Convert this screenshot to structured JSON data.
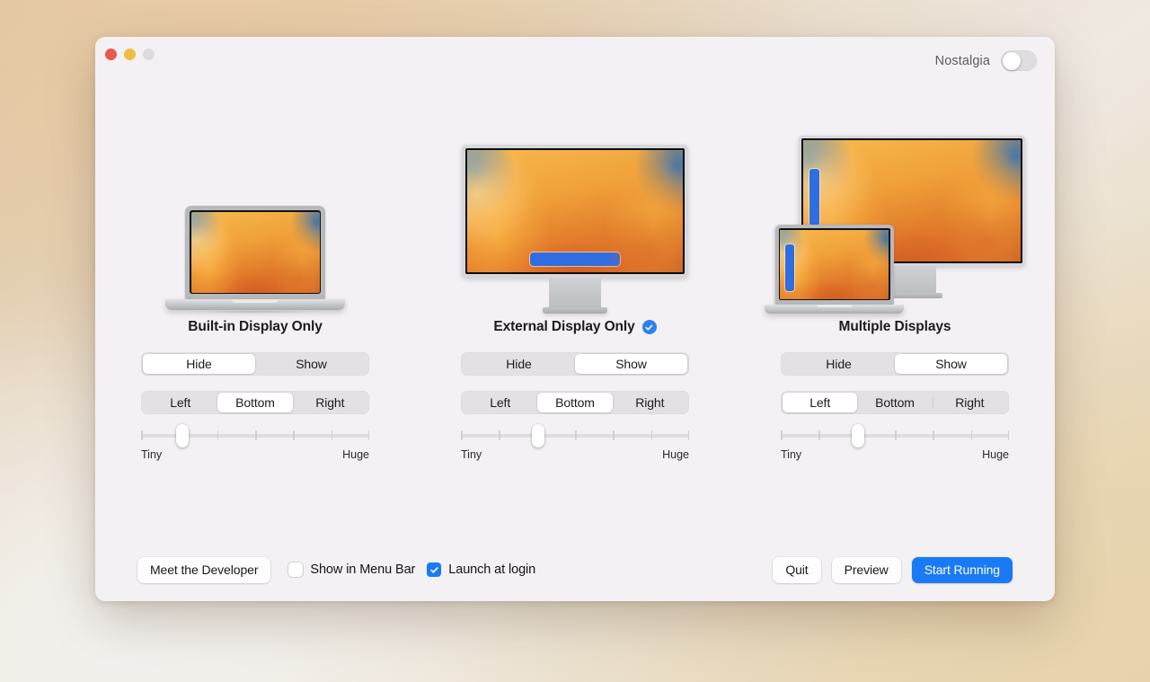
{
  "window": {
    "traffic_lights": [
      "close",
      "minimize",
      "zoom"
    ],
    "nostalgia_label": "Nostalgia",
    "nostalgia_on": false
  },
  "colors": {
    "accent_blue": "#1a7af5",
    "badge_blue": "#2d7ff0",
    "dock_blue": "#2f6ee0",
    "window_bg": "#f4f1f4",
    "segment_track": "#e4e1e5",
    "close_red": "#e8594f",
    "minimize_yellow": "#f0bd40",
    "zoom_gray": "#dcdcdf"
  },
  "slider": {
    "min_label": "Tiny",
    "max_label": "Huge",
    "tick_count": 7
  },
  "visibility_options": [
    "Hide",
    "Show"
  ],
  "position_options": [
    "Left",
    "Bottom",
    "Right"
  ],
  "columns": [
    {
      "id": "built-in-display-only",
      "title": "Built-in Display Only",
      "active": false,
      "artwork": "macbook",
      "visibility": [
        "Hide",
        "Show"
      ],
      "visibility_selected": "Hide",
      "position": [
        "Left",
        "Bottom",
        "Right"
      ],
      "position_selected": "Bottom",
      "slider_value": 18,
      "slider_min_label": "Tiny",
      "slider_max_label": "Huge"
    },
    {
      "id": "external-display-only",
      "title": "External Display Only",
      "active": true,
      "artwork": "external-monitor",
      "visibility": [
        "Hide",
        "Show"
      ],
      "visibility_selected": "Show",
      "position": [
        "Left",
        "Bottom",
        "Right"
      ],
      "position_selected": "Bottom",
      "slider_value": 34,
      "slider_min_label": "Tiny",
      "slider_max_label": "Huge"
    },
    {
      "id": "multiple-displays",
      "title": "Multiple Displays",
      "active": false,
      "artwork": "monitor-and-macbook",
      "visibility": [
        "Hide",
        "Show"
      ],
      "visibility_selected": "Show",
      "position": [
        "Left",
        "Bottom",
        "Right"
      ],
      "position_selected": "Left",
      "slider_value": 34,
      "slider_min_label": "Tiny",
      "slider_max_label": "Huge"
    }
  ],
  "footer": {
    "meet_developer_label": "Meet the Developer",
    "show_in_menu_bar_label": "Show in Menu Bar",
    "show_in_menu_bar_checked": false,
    "launch_at_login_label": "Launch at login",
    "launch_at_login_checked": true,
    "quit_label": "Quit",
    "preview_label": "Preview",
    "start_running_label": "Start Running"
  }
}
